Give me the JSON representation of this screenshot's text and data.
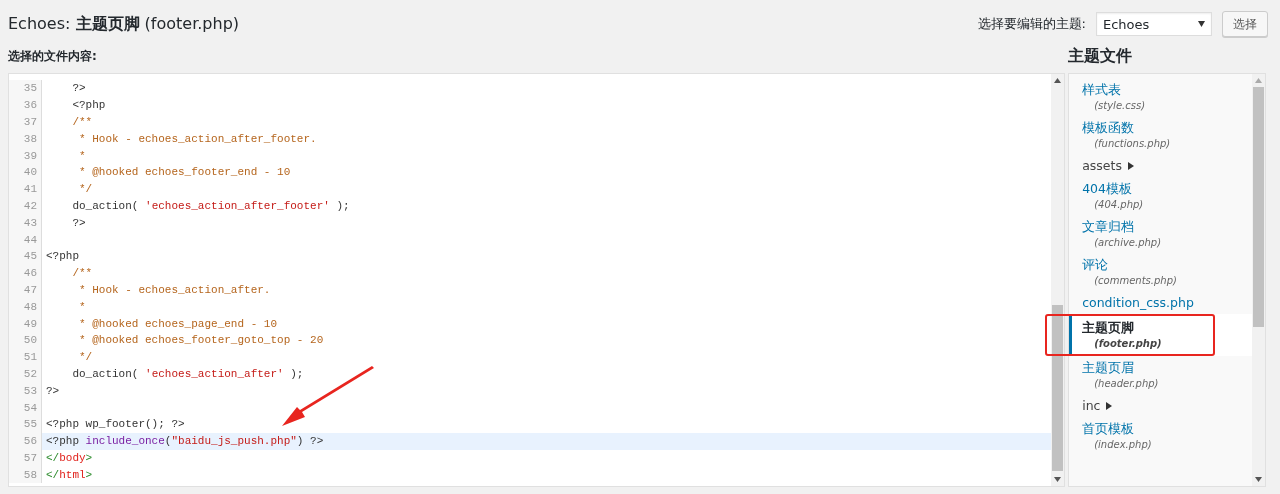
{
  "title": {
    "theme": "Echoes: ",
    "name": "主题页脚",
    "file": " (footer.php)"
  },
  "theme_select": {
    "label": "选择要编辑的主题:",
    "value": "Echoes",
    "button": "选择"
  },
  "content_label": "选择的文件内容:",
  "editor": {
    "lines": [
      {
        "number": "35",
        "active": false,
        "tokens": [
          {
            "kind": "plain",
            "text": "    ?>"
          }
        ]
      },
      {
        "number": "36",
        "active": false,
        "tokens": [
          {
            "kind": "plain",
            "text": "    <?php"
          }
        ]
      },
      {
        "number": "37",
        "active": false,
        "tokens": [
          {
            "kind": "comment",
            "text": "    /**"
          }
        ]
      },
      {
        "number": "38",
        "active": false,
        "tokens": [
          {
            "kind": "comment",
            "text": "     * Hook - echoes_action_after_footer."
          }
        ]
      },
      {
        "number": "39",
        "active": false,
        "tokens": [
          {
            "kind": "comment",
            "text": "     *"
          }
        ]
      },
      {
        "number": "40",
        "active": false,
        "tokens": [
          {
            "kind": "comment",
            "text": "     * @hooked echoes_footer_end - 10"
          }
        ]
      },
      {
        "number": "41",
        "active": false,
        "tokens": [
          {
            "kind": "comment",
            "text": "     */"
          }
        ]
      },
      {
        "number": "42",
        "active": false,
        "tokens": [
          {
            "kind": "plain",
            "text": "    do_action( "
          },
          {
            "kind": "string",
            "text": "'echoes_action_after_footer'"
          },
          {
            "kind": "plain",
            "text": " );"
          }
        ]
      },
      {
        "number": "43",
        "active": false,
        "tokens": [
          {
            "kind": "plain",
            "text": "    ?>"
          }
        ]
      },
      {
        "number": "44",
        "active": false
      },
      {
        "number": "45",
        "active": false,
        "tokens": [
          {
            "kind": "plain",
            "text": "<?php"
          }
        ]
      },
      {
        "number": "46",
        "active": false,
        "tokens": [
          {
            "kind": "comment",
            "text": "    /**"
          }
        ]
      },
      {
        "number": "47",
        "active": false,
        "tokens": [
          {
            "kind": "comment",
            "text": "     * Hook - echoes_action_after."
          }
        ]
      },
      {
        "number": "48",
        "active": false,
        "tokens": [
          {
            "kind": "comment",
            "text": "     *"
          }
        ]
      },
      {
        "number": "49",
        "active": false,
        "tokens": [
          {
            "kind": "comment",
            "text": "     * @hooked echoes_page_end - 10"
          }
        ]
      },
      {
        "number": "50",
        "active": false,
        "tokens": [
          {
            "kind": "comment",
            "text": "     * @hooked echoes_footer_goto_top - 20"
          }
        ]
      },
      {
        "number": "51",
        "active": false,
        "tokens": [
          {
            "kind": "comment",
            "text": "     */"
          }
        ]
      },
      {
        "number": "52",
        "active": false,
        "tokens": [
          {
            "kind": "plain",
            "text": "    do_action( "
          },
          {
            "kind": "string",
            "text": "'echoes_action_after'"
          },
          {
            "kind": "plain",
            "text": " );"
          }
        ]
      },
      {
        "number": "53",
        "active": false,
        "tokens": [
          {
            "kind": "plain",
            "text": "?>"
          }
        ]
      },
      {
        "number": "54",
        "active": false
      },
      {
        "number": "55",
        "active": false,
        "tokens": [
          {
            "kind": "plain",
            "text": "<?php wp_footer(); ?>"
          }
        ]
      },
      {
        "number": "56",
        "active": true,
        "tokens": [
          {
            "kind": "plain",
            "text": "<?php "
          },
          {
            "kind": "keyword",
            "text": "include_once"
          },
          {
            "kind": "plain",
            "text": "("
          },
          {
            "kind": "string",
            "text": "\"baidu_js_push.php\""
          },
          {
            "kind": "plain",
            "text": ") ?>"
          }
        ]
      },
      {
        "number": "57",
        "active": false,
        "tokens": [
          {
            "kind": "bracket",
            "text": "</"
          },
          {
            "kind": "tag",
            "text": "body"
          },
          {
            "kind": "bracket",
            "text": ">"
          }
        ]
      },
      {
        "number": "58",
        "active": false,
        "tokens": [
          {
            "kind": "bracket",
            "text": "</"
          },
          {
            "kind": "tag",
            "text": "html"
          },
          {
            "kind": "bracket",
            "text": ">"
          }
        ]
      }
    ]
  },
  "theme_files": {
    "heading": "主题文件",
    "items": [
      {
        "kind": "file",
        "label": "样式表",
        "file": "(style.css)",
        "selected": false
      },
      {
        "kind": "file",
        "label": "模板函数",
        "file": "(functions.php)",
        "selected": false
      },
      {
        "kind": "folder",
        "label": "assets"
      },
      {
        "kind": "file",
        "label": "404模板",
        "file": "(404.php)",
        "selected": false
      },
      {
        "kind": "file",
        "label": "文章归档",
        "file": "(archive.php)",
        "selected": false
      },
      {
        "kind": "file",
        "label": "评论",
        "file": "(comments.php)",
        "selected": false
      },
      {
        "kind": "file",
        "label": "condition_css.php",
        "selected": false
      },
      {
        "kind": "file",
        "label": "主题页脚",
        "file": "(footer.php)",
        "selected": true
      },
      {
        "kind": "file",
        "label": "主题页眉",
        "file": "(header.php)",
        "selected": false
      },
      {
        "kind": "folder",
        "label": "inc"
      },
      {
        "kind": "file",
        "label": "首页模板",
        "file": "(index.php)",
        "selected": false
      }
    ]
  }
}
